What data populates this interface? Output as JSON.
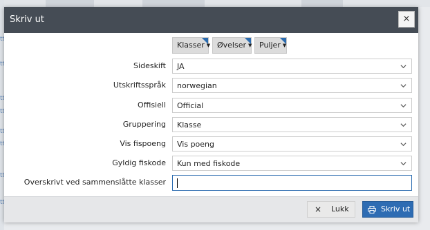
{
  "dialog": {
    "title": "Skriv ut",
    "close_label": "×"
  },
  "filters": [
    {
      "label": "Klasser"
    },
    {
      "label": "Øvelser"
    },
    {
      "label": "Puljer"
    }
  ],
  "fields": [
    {
      "label": "Sideskift",
      "value": "JA"
    },
    {
      "label": "Utskriftsspråk",
      "value": "norwegian"
    },
    {
      "label": "Offisiell",
      "value": "Official"
    },
    {
      "label": "Gruppering",
      "value": "Klasse"
    },
    {
      "label": "Vis fispoeng",
      "value": "Vis poeng"
    },
    {
      "label": "Gyldig fiskode",
      "value": "Kun med fiskode"
    }
  ],
  "override": {
    "label": "Overskrivt ved sammenslåtte klasser",
    "value": ""
  },
  "footer": {
    "close_icon": "×",
    "close_label": "Lukk",
    "print_label": "Skriv ut"
  },
  "icons": {
    "close": "close-icon",
    "caret": "caret-down-icon",
    "chevron": "chevron-down-icon",
    "print": "printer-icon"
  },
  "colors": {
    "titlebar": "#454c55",
    "accent": "#2e6cb3",
    "footer": "#e6e7e9"
  }
}
